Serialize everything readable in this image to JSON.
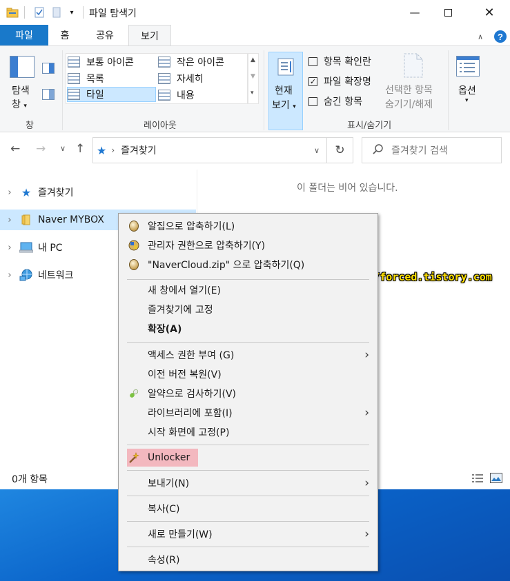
{
  "window": {
    "title": "파일 탐색기"
  },
  "ribbon_tabs": [
    "파일",
    "홈",
    "공유",
    "보기"
  ],
  "ribbon": {
    "pane_button": {
      "line1": "탐색",
      "line2": "창"
    },
    "pane_group_label": "창",
    "layout_items": [
      "보통 아이콘",
      "작은 아이콘",
      "목록",
      "자세히",
      "타일",
      "내용"
    ],
    "layout_selected": "타일",
    "layout_group_label": "레이아웃",
    "current_view": {
      "line1": "현재",
      "line2": "보기"
    },
    "checkboxes": [
      {
        "label": "항목 확인란",
        "checked": false
      },
      {
        "label": "파일 확장명",
        "checked": true
      },
      {
        "label": "숨긴 항목",
        "checked": false
      }
    ],
    "hide_selected": {
      "line1": "선택한 항목",
      "line2": "숨기기/해제"
    },
    "showhide_group_label": "표시/숨기기",
    "options_label": "옵션"
  },
  "address": {
    "path": "즐겨찾기",
    "search_placeholder": "즐겨찾기 검색"
  },
  "nav_items": [
    {
      "label": "즐겨찾기",
      "icon": "star-icon",
      "selected": false
    },
    {
      "label": "Naver MYBOX",
      "icon": "folder-icon",
      "selected": true
    },
    {
      "label": "내 PC",
      "icon": "pc-icon",
      "selected": false
    },
    {
      "label": "네트워크",
      "icon": "network-icon",
      "selected": false
    }
  ],
  "content": {
    "empty_message": "이 폴더는 비어 있습니다."
  },
  "status": {
    "item_count": "0개 항목"
  },
  "watermark": "https://forced.tistory.com",
  "context_menu": {
    "items": [
      {
        "label": "알집으로 압축하기(L)",
        "icon": "alzip-icon"
      },
      {
        "label": "관리자 권한으로 압축하기(Y)",
        "icon": "admin-compress-icon"
      },
      {
        "label": "\"NaverCloud.zip\" 으로 압축하기(Q)",
        "icon": "alzip-icon"
      },
      {
        "label": "새 창에서 열기(E)"
      },
      {
        "label": "즐겨찾기에 고정"
      },
      {
        "label": "확장(A)",
        "bold": true
      },
      {
        "label": "액세스 권한 부여 (G)",
        "submenu": true
      },
      {
        "label": "이전 버전 복원(V)"
      },
      {
        "label": "알약으로 검사하기(V)",
        "icon": "alyac-icon"
      },
      {
        "label": "라이브러리에 포함(I)",
        "submenu": true
      },
      {
        "label": "시작 화면에 고정(P)"
      },
      {
        "label": "Unlocker",
        "icon": "unlocker-wand-icon",
        "highlight": true
      },
      {
        "label": "보내기(N)",
        "submenu": true
      },
      {
        "label": "복사(C)"
      },
      {
        "label": "새로 만들기(W)",
        "submenu": true
      },
      {
        "label": "속성(R)"
      }
    ]
  },
  "colors": {
    "file_tab": "#1979ca",
    "selection": "#cce8ff",
    "unlocker_highlight": "#f3b8bf",
    "desktop": "#0a63c9"
  }
}
